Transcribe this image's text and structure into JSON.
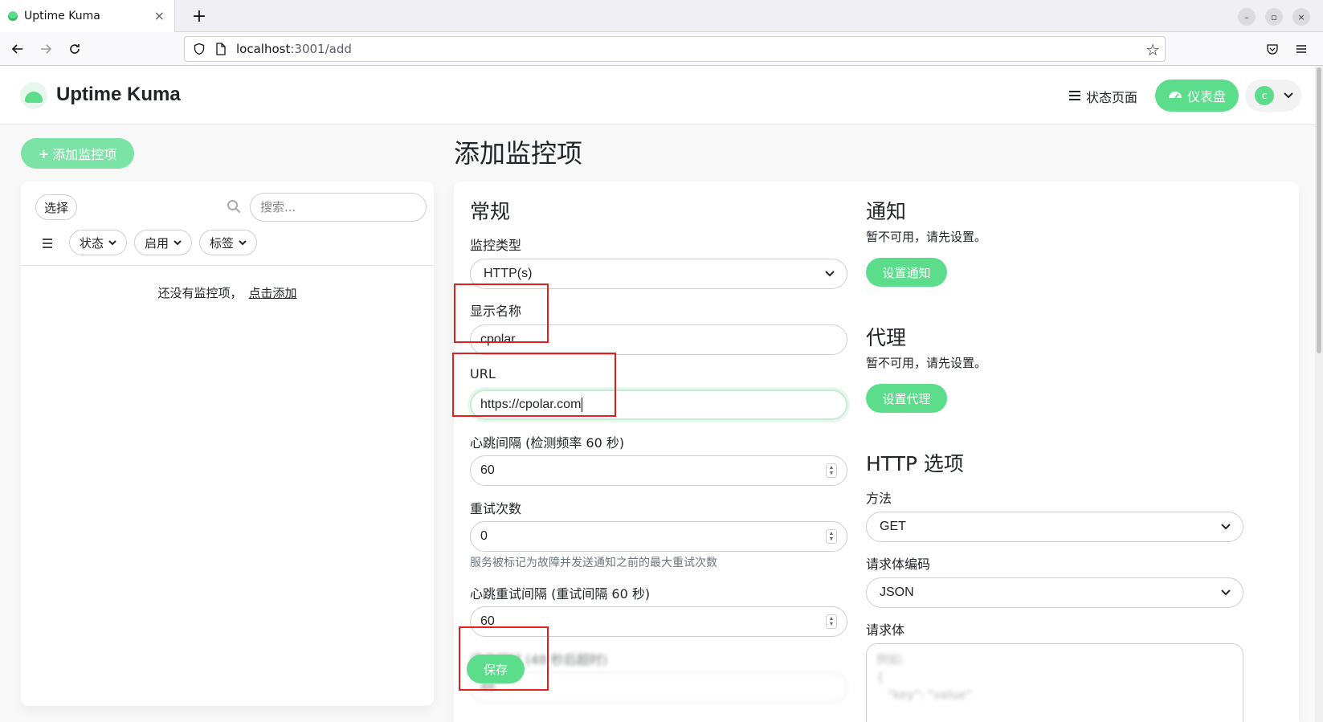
{
  "browser": {
    "tab_title": "Uptime Kuma",
    "tab_close": "×",
    "new_tab": "+",
    "url_host": "localhost",
    "url_rest": ":3001/add",
    "win_min": "–",
    "win_max": "▫",
    "win_close": "×"
  },
  "header": {
    "app_title": "Uptime Kuma",
    "status_page_label": "状态页面",
    "dashboard_label": "仪表盘",
    "avatar_letter": "c"
  },
  "sidebar": {
    "add_monitor_label": "添加监控项",
    "select_label": "选择",
    "search_placeholder": "搜索...",
    "filters": [
      "状态",
      "启用",
      "标签"
    ],
    "empty_text": "还没有监控项，",
    "empty_link": "点击添加"
  },
  "form": {
    "page_title": "添加监控项",
    "general_title": "常规",
    "monitor_type_label": "监控类型",
    "monitor_type_value": "HTTP(s)",
    "display_name_label": "显示名称",
    "display_name_value": "cpolar",
    "url_label": "URL",
    "url_value": "https://cpolar.com",
    "heartbeat_label": "心跳间隔 (检测频率 60 秒)",
    "heartbeat_value": "60",
    "retries_label": "重试次数",
    "retries_value": "0",
    "retries_help": "服务被标记为故障并发送通知之前的最大重试次数",
    "retry_interval_label": "心跳重试间隔 (重试间隔 60 秒)",
    "retry_interval_value": "60",
    "timeout_label": "请求超时 (48 秒后超时)",
    "timeout_value": "48",
    "save_label": "保存"
  },
  "notifications": {
    "title": "通知",
    "unavailable": "暂不可用，请先设置。",
    "setup_label": "设置通知"
  },
  "proxy": {
    "title": "代理",
    "unavailable": "暂不可用，请先设置。",
    "setup_label": "设置代理"
  },
  "http_options": {
    "title": "HTTP 选项",
    "method_label": "方法",
    "method_value": "GET",
    "body_encoding_label": "请求体编码",
    "body_encoding_value": "JSON",
    "body_label": "请求体",
    "body_placeholder_line1": "例如:",
    "body_placeholder_line2": "{",
    "body_placeholder_line3": "\"key\": \"value\""
  },
  "colors": {
    "accent": "#5cdd8b",
    "annotation_red": "#e02020"
  }
}
